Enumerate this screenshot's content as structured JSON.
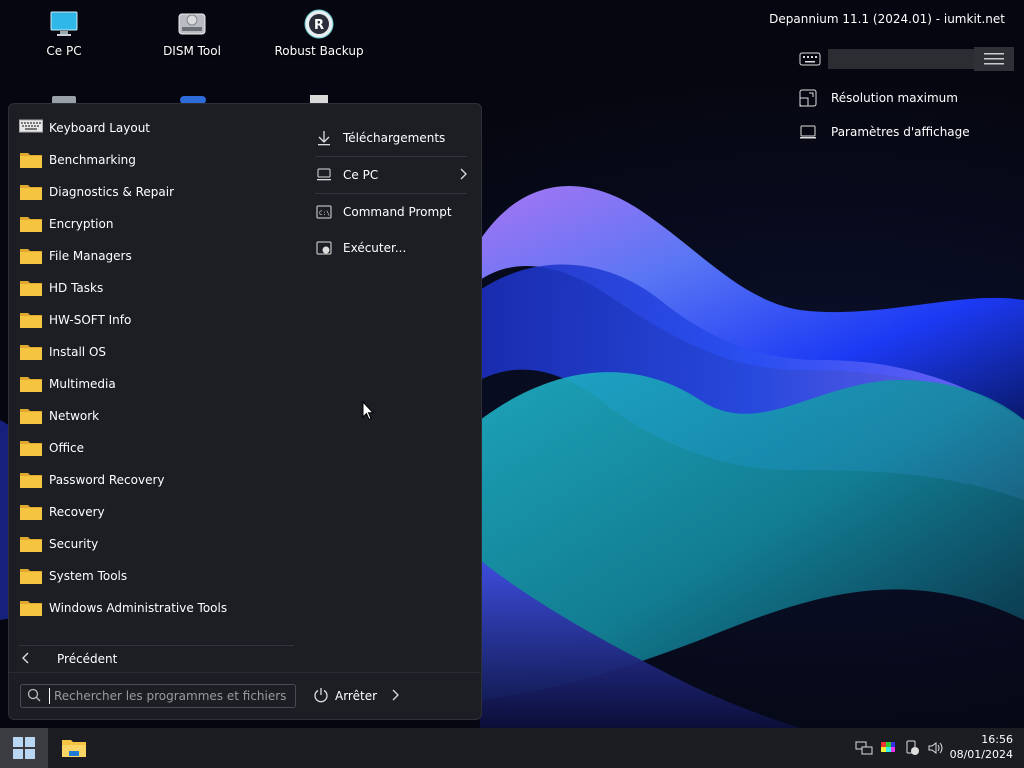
{
  "desktop": {
    "icons": [
      {
        "label": "Ce PC",
        "icon": "monitor-icon"
      },
      {
        "label": "DISM Tool",
        "icon": "drive-icon"
      },
      {
        "label": "Robust Backup",
        "icon": "backup-icon"
      }
    ]
  },
  "top_right": {
    "title": "Depannium 11.1 (2024.01) - iumkit.net",
    "links": [
      {
        "label": "Résolution maximum",
        "icon": "resolution-icon"
      },
      {
        "label": "Paramètres d'affichage",
        "icon": "display-icon"
      }
    ]
  },
  "start_menu": {
    "items": [
      {
        "label": "Keyboard Layout",
        "icon": "keyboard-icon"
      },
      {
        "label": "Benchmarking",
        "icon": "folder-icon"
      },
      {
        "label": "Diagnostics & Repair",
        "icon": "folder-icon"
      },
      {
        "label": "Encryption",
        "icon": "folder-icon"
      },
      {
        "label": "File Managers",
        "icon": "folder-icon"
      },
      {
        "label": "HD Tasks",
        "icon": "folder-icon"
      },
      {
        "label": "HW-SOFT Info",
        "icon": "folder-icon"
      },
      {
        "label": "Install OS",
        "icon": "folder-icon"
      },
      {
        "label": "Multimedia",
        "icon": "folder-icon"
      },
      {
        "label": "Network",
        "icon": "folder-icon"
      },
      {
        "label": "Office",
        "icon": "folder-icon"
      },
      {
        "label": "Password Recovery",
        "icon": "folder-icon"
      },
      {
        "label": "Recovery",
        "icon": "folder-icon"
      },
      {
        "label": "Security",
        "icon": "folder-icon"
      },
      {
        "label": "System Tools",
        "icon": "folder-icon"
      },
      {
        "label": "Windows Administrative Tools",
        "icon": "folder-icon"
      }
    ],
    "back_label": "Précédent",
    "right_items": [
      {
        "label": "Téléchargements",
        "icon": "download-icon"
      },
      {
        "label": "Ce PC",
        "icon": "computer-icon"
      },
      {
        "label": "Command Prompt",
        "icon": "cmd-icon"
      },
      {
        "label": "Exécuter...",
        "icon": "run-icon"
      }
    ],
    "search_placeholder": "Rechercher les programmes et fichiers",
    "power_label": "Arrêter"
  },
  "taskbar": {
    "time": "16:56",
    "date": "08/01/2024"
  },
  "colors": {
    "folder": "#f5c542",
    "menu_bg": "#1c1e24",
    "taskbar_bg": "#1b1d22"
  }
}
